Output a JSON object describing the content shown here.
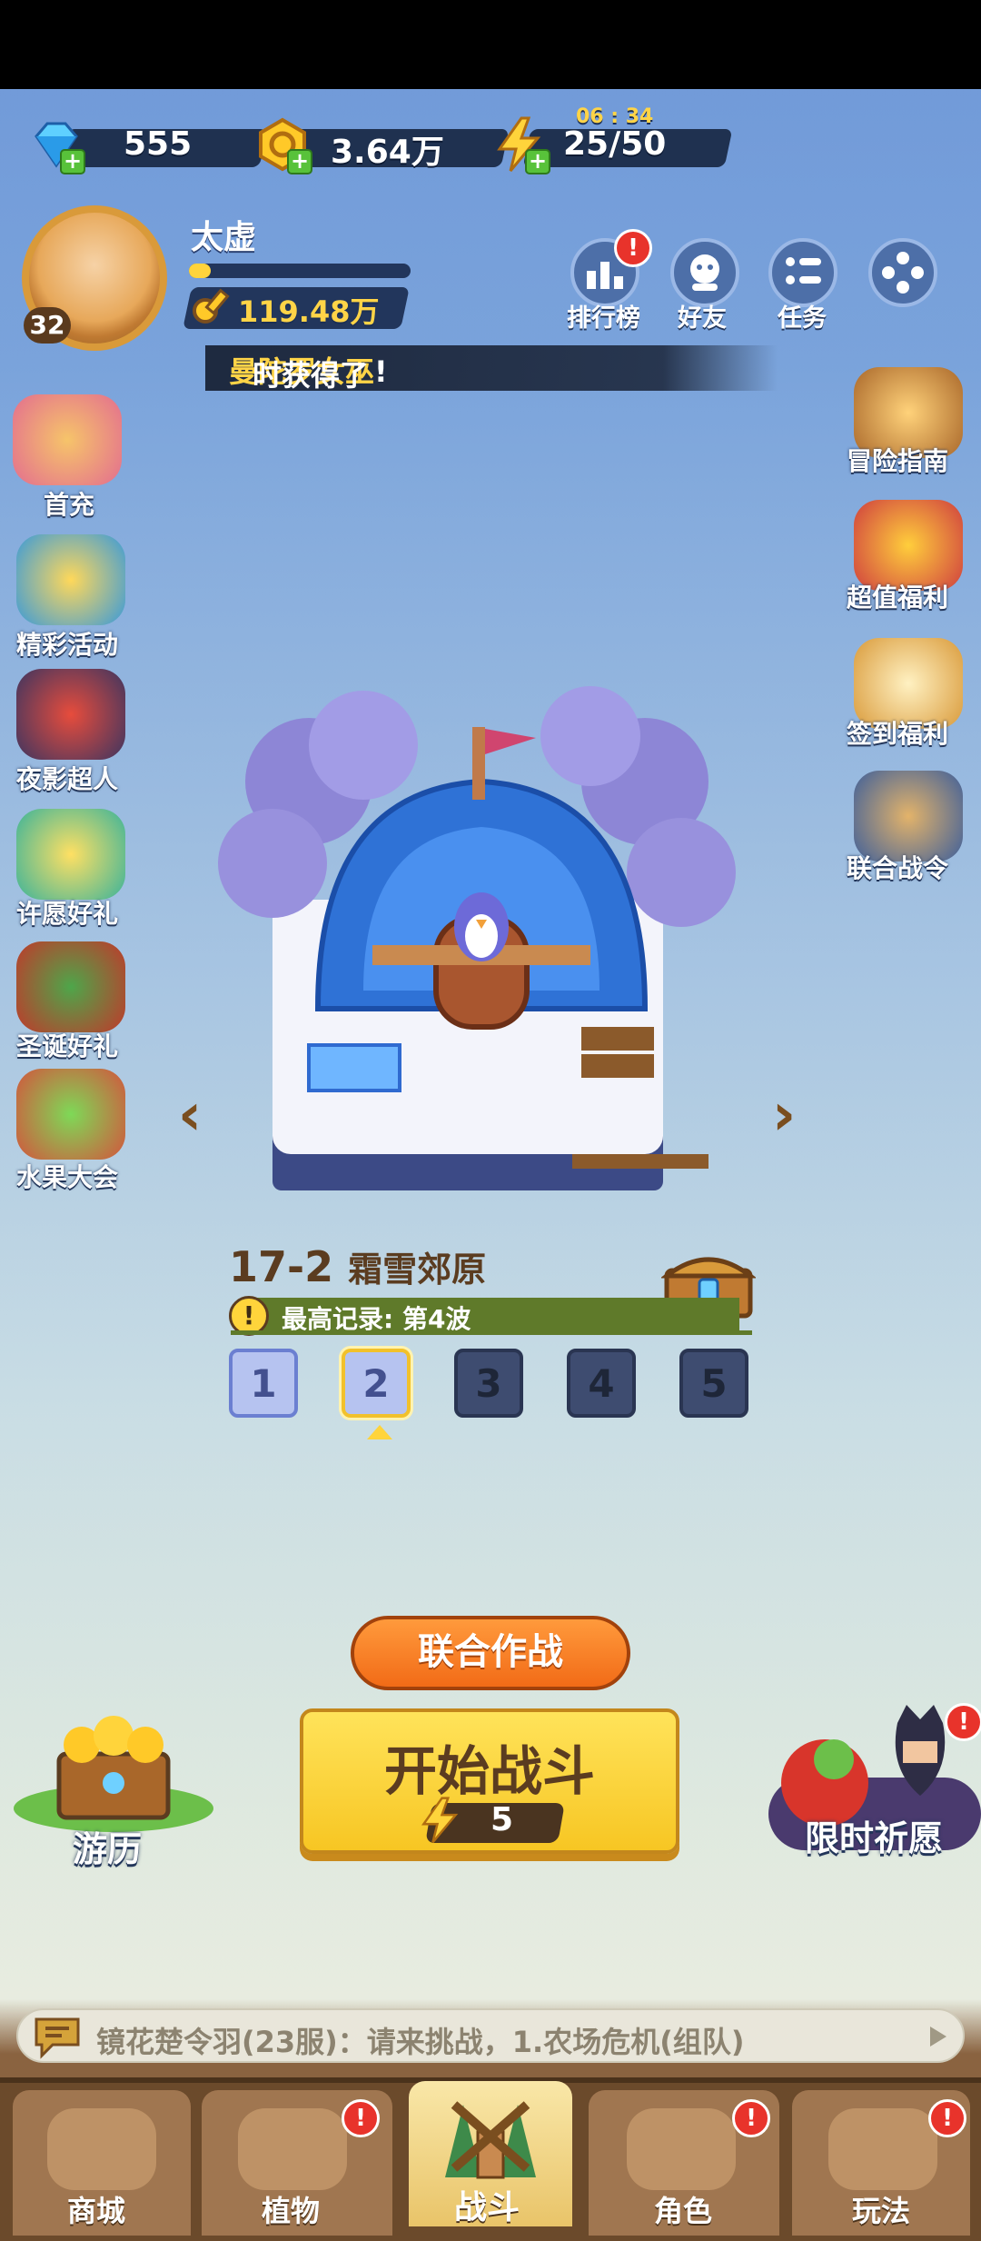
{
  "resources": {
    "diamonds": "555",
    "gold": "3.64万",
    "energy": "25/50",
    "energy_timer": "06 : 34"
  },
  "player": {
    "name": "太虚",
    "level": "32",
    "power": "119.48万",
    "xp_fraction": 0.1
  },
  "top_buttons": {
    "ranking": "排行榜",
    "friends": "好友",
    "tasks": "任务",
    "ranking_badge": "!"
  },
  "broadcast": {
    "prefix": "时获得了",
    "highlight": "曼陀罗女巫",
    "suffix": "!"
  },
  "left_menu": [
    "首充",
    "精彩活动",
    "夜影超人",
    "许愿好礼",
    "圣诞好礼",
    "水果大会"
  ],
  "right_menu": [
    "冒险指南",
    "超值福利",
    "签到福利",
    "联合战令"
  ],
  "stage": {
    "id": "17-2",
    "name": "霜雪郊原",
    "record": "最高记录: 第4波",
    "waves": [
      "1",
      "2",
      "3",
      "4",
      "5"
    ],
    "current_wave": 2
  },
  "actions": {
    "coop": "联合作战",
    "start": "开始战斗",
    "start_cost": "5",
    "journey": "游历",
    "limited_wish": "限时祈愿",
    "wish_badge": "!"
  },
  "chat": {
    "message": "镜花楚令羽(23服)：请来挑战，1.农场危机(组队)"
  },
  "nav": {
    "tabs": [
      "商城",
      "植物",
      "战斗",
      "角色",
      "玩法"
    ],
    "active": "战斗",
    "badge": "!"
  },
  "colors": {
    "accent_yellow": "#ffd43b",
    "badge_red": "#e8332b",
    "panel_navy": "#1f3150",
    "nav_brown": "#6b4a2b"
  }
}
